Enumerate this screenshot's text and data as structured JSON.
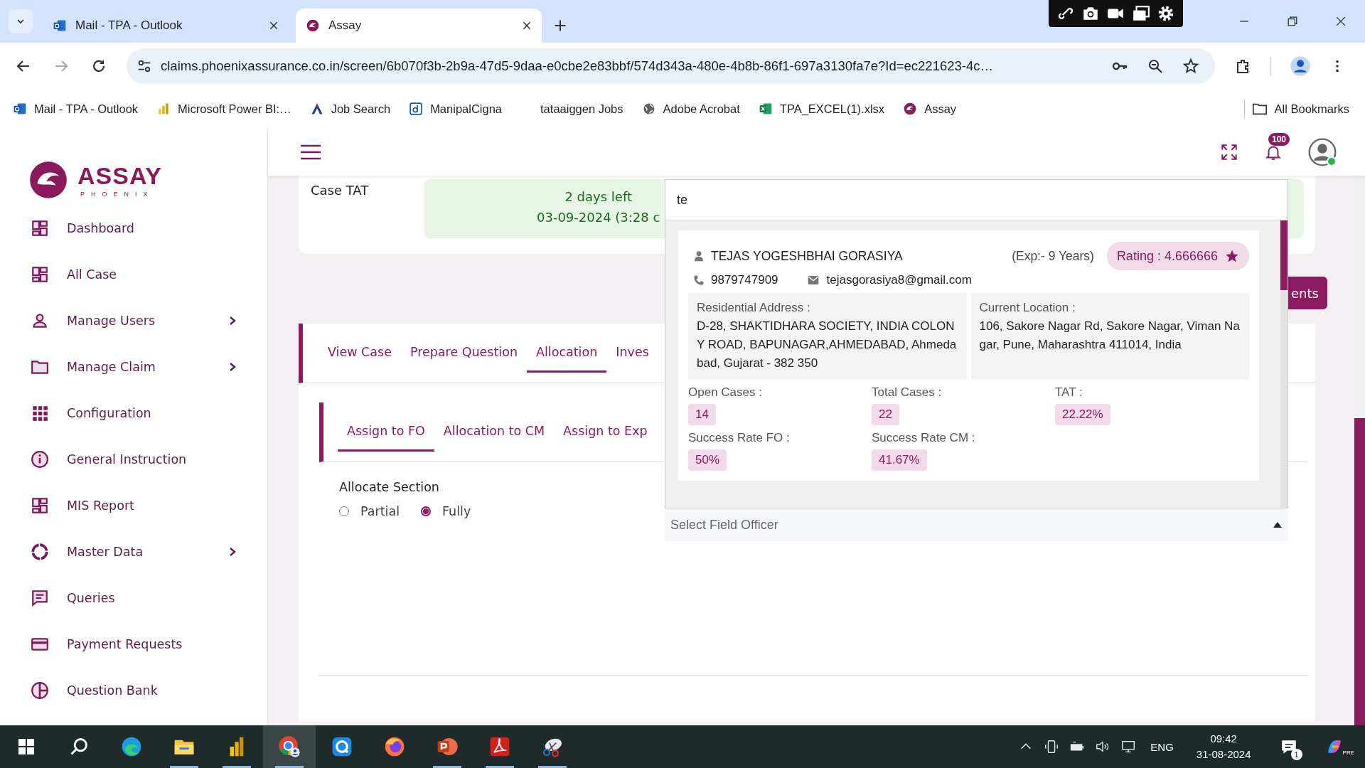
{
  "browser": {
    "tabs": [
      {
        "title": "Mail - TPA - Outlook",
        "kind": "outlook",
        "selected": false
      },
      {
        "title": "Assay",
        "kind": "assay",
        "selected": true
      }
    ],
    "address": "claims.phoenixassurance.co.in/screen/6b070f3b-2b9a-47d5-9daa-e0cbe2e83bbf/574d343a-480e-4b8b-86f1-697a3130fa7e?Id=ec221623-4c…",
    "bookmarks": [
      {
        "label": "Mail - TPA - Outlook",
        "kind": "outlook"
      },
      {
        "label": "Microsoft Power BI:…",
        "kind": "powerbi"
      },
      {
        "label": "Job Search",
        "kind": "jobsearch"
      },
      {
        "label": "ManipalCigna",
        "kind": "manipal"
      },
      {
        "label": "tataaiggen Jobs"
      },
      {
        "label": "Adobe Acrobat",
        "kind": "globe"
      },
      {
        "label": "TPA_EXCEL(1).xlsx",
        "kind": "excel"
      },
      {
        "label": "Assay",
        "kind": "assay"
      }
    ],
    "all_bookmarks": "All Bookmarks"
  },
  "app": {
    "logo": {
      "name": "ASSAY",
      "tagline": "PHOENIX"
    },
    "sidebar": [
      {
        "label": "Dashboard",
        "kind": "dashboard",
        "has_submenu": false
      },
      {
        "label": "All Case",
        "kind": "dashboard",
        "has_submenu": false
      },
      {
        "label": "Manage Users",
        "kind": "person",
        "has_submenu": true
      },
      {
        "label": "Manage Claim",
        "kind": "folder",
        "has_submenu": true
      },
      {
        "label": "Configuration",
        "kind": "grid",
        "has_submenu": false
      },
      {
        "label": "General Instruction",
        "kind": "info",
        "has_submenu": false
      },
      {
        "label": "MIS Report",
        "kind": "dashboard",
        "has_submenu": false
      },
      {
        "label": "Master Data",
        "kind": "ring",
        "has_submenu": true
      },
      {
        "label": "Queries",
        "kind": "chat",
        "has_submenu": false
      },
      {
        "label": "Payment Requests",
        "kind": "card",
        "has_submenu": false
      },
      {
        "label": "Question Bank",
        "kind": "pie",
        "has_submenu": false
      }
    ],
    "notification_count": "100",
    "case_tat": {
      "label": "Case TAT",
      "days_left": "2 days left",
      "due": "03-09-2024 (3:28 c"
    },
    "action_button": "ents",
    "tabs": [
      {
        "label": "View Case",
        "selected": false
      },
      {
        "label": "Prepare Question",
        "selected": false
      },
      {
        "label": "Allocation",
        "selected": true
      },
      {
        "label": "Inves",
        "selected": false
      }
    ],
    "subtabs": [
      {
        "label": "Assign to FO",
        "selected": true
      },
      {
        "label": "Allocation to CM",
        "selected": false
      },
      {
        "label": "Assign to Exp",
        "selected": false
      }
    ],
    "allocate_section": {
      "label": "Allocate Section",
      "options": [
        {
          "label": "Partial",
          "selected": false
        },
        {
          "label": "Fully",
          "selected": true
        }
      ]
    },
    "field_officer": {
      "search": "te",
      "placeholder": "Select Field Officer",
      "results": [
        {
          "name": "TEJAS YOGESHBHAI GORASIYA",
          "experience": "(Exp:- 9 Years)",
          "rating": "Rating : 4.666666",
          "phone": "9879747909",
          "email": "tejasgorasiya8@gmail.com",
          "residential_label": "Residential Address :",
          "residential": "D-28, SHAKTIDHARA SOCIETY, INDIA COLONY ROAD, BAPUNAGAR,AHMEDABAD, Ahmedabad, Gujarat - 382 350",
          "location_label": "Current Location :",
          "location": "106, Sakore Nagar Rd, Sakore Nagar, Viman Nagar, Pune, Maharashtra 411014, India",
          "stats": [
            {
              "label": "Open Cases :",
              "value": "14"
            },
            {
              "label": "Total Cases :",
              "value": "22"
            },
            {
              "label": "TAT :",
              "value": "22.22%"
            },
            {
              "label": "Success Rate FO :",
              "value": "50%"
            },
            {
              "label": "Success Rate CM :",
              "value": "41.67%"
            }
          ]
        }
      ]
    }
  },
  "taskbar": {
    "apps": [
      {
        "kind": "edge",
        "open": false,
        "selected": false
      },
      {
        "kind": "files",
        "open": true,
        "selected": false
      },
      {
        "kind": "powerbi",
        "open": true,
        "selected": false
      },
      {
        "kind": "chrome",
        "open": true,
        "selected": true
      },
      {
        "kind": "q",
        "open": false,
        "selected": false
      },
      {
        "kind": "firefox",
        "open": false,
        "selected": false
      },
      {
        "kind": "powerpoint",
        "open": true,
        "selected": false
      },
      {
        "kind": "acrobat",
        "open": true,
        "selected": false
      },
      {
        "kind": "snipping",
        "open": true,
        "selected": false
      }
    ],
    "language": "ENG",
    "time": "09:42",
    "date": "31-08-2024",
    "notification_count": "1",
    "copilot_badge": "PRE"
  }
}
